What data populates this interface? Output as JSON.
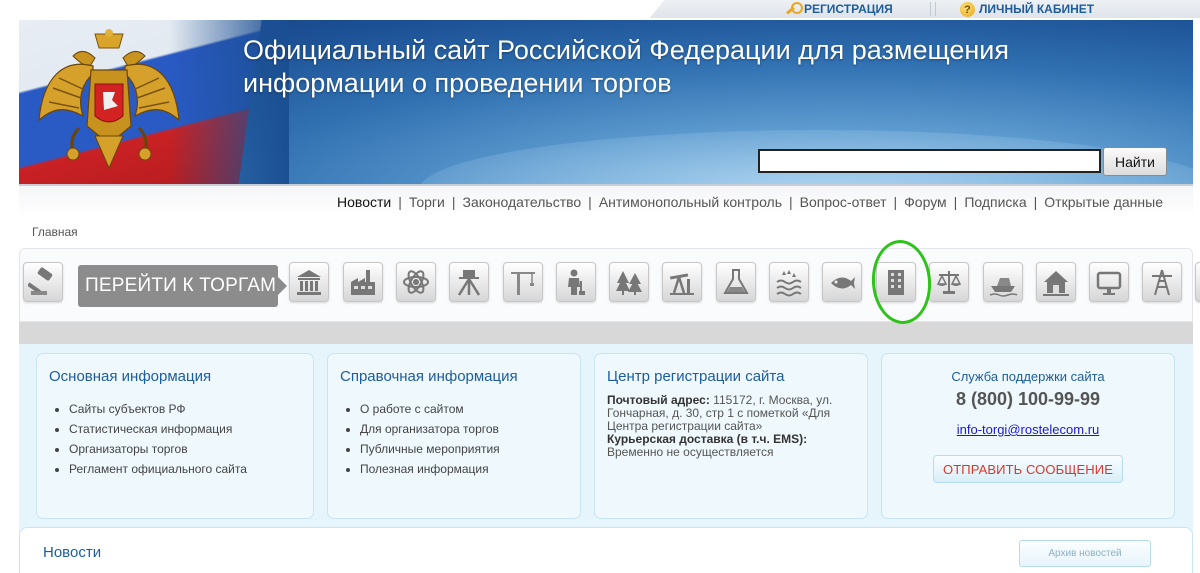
{
  "topbar": {
    "register_label": "РЕГИСТРАЦИЯ",
    "cabinet_label": "ЛИЧНЫЙ КАБИНЕТ"
  },
  "header": {
    "title_line1": "Официальный сайт Российской Федерации для размещения",
    "title_line2": "информации о проведении торгов",
    "search": {
      "value": "",
      "placeholder": "",
      "button_label": "Найти"
    }
  },
  "nav": {
    "items": [
      {
        "label": "Новости",
        "active": true
      },
      {
        "label": "Торги"
      },
      {
        "label": "Законодательство"
      },
      {
        "label": "Антимонопольный контроль"
      },
      {
        "label": "Вопрос-ответ"
      },
      {
        "label": "Форум"
      },
      {
        "label": "Подписка"
      },
      {
        "label": "Открытые данные"
      }
    ],
    "separator": "|"
  },
  "breadcrumb": {
    "current": "Главная"
  },
  "categories": {
    "goto_label": "ПЕРЕЙТИ К ТОРГАМ",
    "icons": [
      "gavel-icon",
      "government-building-icon",
      "factory-icon",
      "atom-icon",
      "theodolite-icon",
      "crane-icon",
      "worker-icon",
      "forest-icon",
      "oil-pump-icon",
      "flask-icon",
      "water-icon",
      "fish-icon",
      "building-icon",
      "scales-icon",
      "boat-icon",
      "house-icon",
      "tv-icon",
      "power-line-icon",
      "radio-tower-icon"
    ],
    "highlight_color": "#2ec21a"
  },
  "info": {
    "main": {
      "title": "Основная информация",
      "items": [
        "Сайты субъектов РФ",
        "Статистическая информация",
        "Организаторы торгов",
        "Регламент официального сайта"
      ]
    },
    "reference": {
      "title": "Справочная информация",
      "items": [
        "О работе с сайтом",
        "Для организатора торгов",
        "Публичные мероприятия",
        "Полезная информация"
      ]
    },
    "registration": {
      "title": "Центр регистрации сайта",
      "postal_label": "Почтовый адрес:",
      "postal_value": "115172, г. Москва, ул. Гончарная, д. 30, стр 1 с пометкой «Для Центра регистрации сайта»",
      "courier_label": "Курьерская доставка (в т.ч. EMS):",
      "courier_value": "Временно не осуществляется"
    },
    "support": {
      "title": "Служба поддержки сайта",
      "phone": "8 (800) 100-99-99",
      "email": "info-torgi@rostelecom.ru",
      "send_label": "ОТПРАВИТЬ СООБЩЕНИЕ"
    }
  },
  "news": {
    "title": "Новости",
    "archive_label": "Архив новостей"
  },
  "colors": {
    "link": "#1d5d9e",
    "accent_red": "#d33a2c",
    "panel_bg": "#e6f4fb"
  }
}
